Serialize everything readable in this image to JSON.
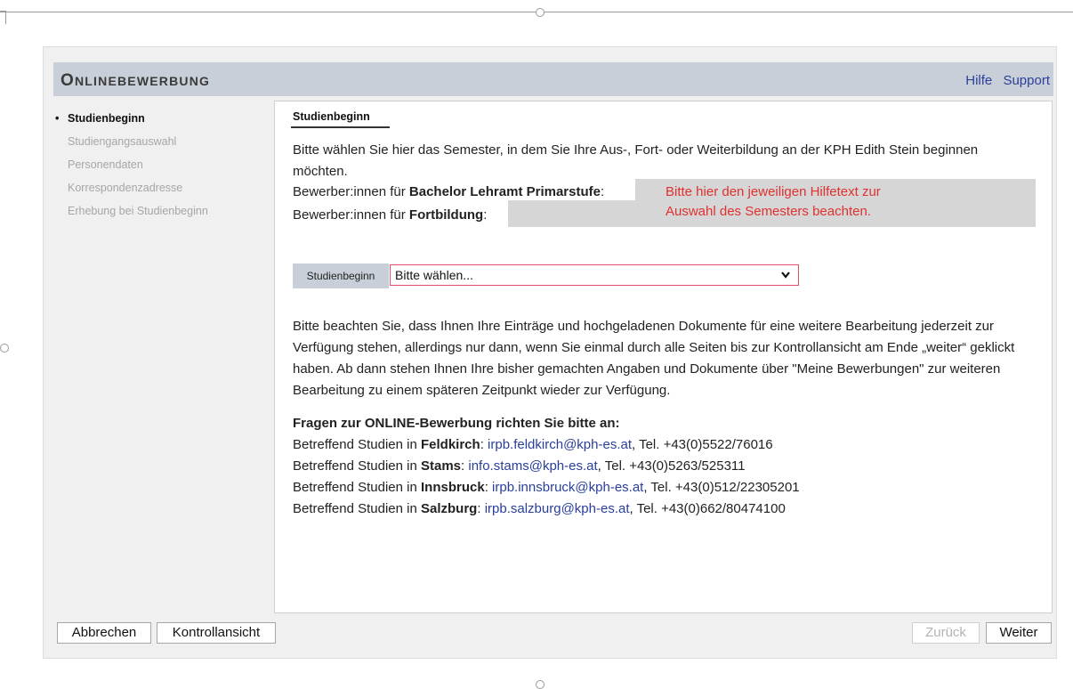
{
  "header": {
    "title_first": "O",
    "title_rest": "NLINEBEWERBUNG",
    "links": [
      "Hilfe",
      "Support"
    ]
  },
  "sidebar": {
    "items": [
      {
        "label": "Studienbeginn",
        "active": true
      },
      {
        "label": "Studiengangsauswahl",
        "active": false
      },
      {
        "label": "Personendaten",
        "active": false
      },
      {
        "label": "Korrespondenzadresse",
        "active": false
      },
      {
        "label": "Erhebung bei Studienbeginn",
        "active": false
      }
    ],
    "bullet": "•"
  },
  "tab": {
    "label": "Studienbeginn"
  },
  "intro": "Bitte wählen Sie hier das Semester, in dem Sie Ihre Aus-, Fort- oder Weiterbildung an der KPH Edith Stein beginnen möchten.",
  "applicants": {
    "bachelor_prefix": "Bewerber:innen für ",
    "bachelor_bold": "Bachelor Lehramt Primarstufe",
    "fort_prefix": "Bewerber:innen für ",
    "fort_bold": "Fortbildung",
    "colon": ":"
  },
  "note": {
    "line1": "Bitte hier den jeweiligen Hilfetext zur",
    "line2": "Auswahl des Semesters beachten.",
    "color": "#e03030"
  },
  "select": {
    "label": "Studienbeginn",
    "value": "Bitte wählen...",
    "chevron": "⌄"
  },
  "body": "Bitte beachten Sie, dass Ihnen Ihre Einträge und hochgeladenen Dokumente für eine weitere Bearbeitung jederzeit zur Verfügung stehen, allerdings nur dann, wenn Sie einmal durch alle Seiten bis zur Kontrollansicht am Ende „weiter“ geklickt haben. Ab dann stehen Ihnen Ihre bisher gemachten Angaben und Dokumente über \"Meine Bewerbungen\" zur weiteren Bearbeitung zu einem späteren Zeitpunkt wieder zur Verfügung.",
  "questions_heading": "Fragen zur ONLINE-Bewerbung richten Sie bitte an:",
  "contacts": [
    {
      "prefix": "Betreffend Studien in ",
      "city": "Feldkirch",
      "email": "irpb.feldkirch@kph-es.at",
      "phone": ", Tel. +43(0)5522/76016"
    },
    {
      "prefix": "Betreffend Studien in ",
      "city": "Stams",
      "email": "info.stams@kph-es.at",
      "phone": ", Tel. +43(0)5263/525311"
    },
    {
      "prefix": "Betreffend Studien in ",
      "city": "Innsbruck",
      "email": "irpb.innsbruck@kph-es.at",
      "phone": ", Tel. +43(0)512/22305201"
    },
    {
      "prefix": "Betreffend Studien in ",
      "city": "Salzburg",
      "email": "irpb.salzburg@kph-es.at",
      "phone": ", Tel. +43(0)662/80474100"
    }
  ],
  "contact_colon": ": ",
  "buttons": {
    "cancel": "Abbrechen",
    "review": "Kontrollansicht",
    "back": "Zurück",
    "next": "Weiter"
  }
}
